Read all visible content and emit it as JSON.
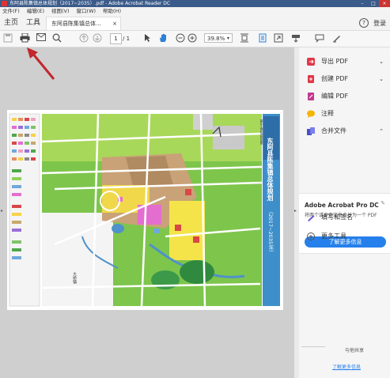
{
  "window": {
    "title": "东阿县陈集镇总体规划（2017~2035）.pdf - Adobe Acrobat Reader DC"
  },
  "menu": {
    "items": [
      "文件(F)",
      "编辑(E)",
      "视图(V)",
      "窗口(W)",
      "帮助(H)"
    ]
  },
  "tabs": {
    "home": "主页",
    "tools": "工具",
    "doc": "东阿县陈集镇总体...",
    "close": "×"
  },
  "header": {
    "help": "?",
    "login": "登录"
  },
  "toolbar": {
    "page_current": "1",
    "page_total": "/ 1",
    "zoom": "39.8%"
  },
  "map": {
    "title": "东阿县陈集镇总体规划",
    "years": "（2017~2035年）",
    "subtitle": "镇区土地利用规划图",
    "place": "大桥镇"
  },
  "panel": {
    "tools": [
      {
        "label": "导出 PDF",
        "icon": "export-pdf-icon",
        "color": "#e0384a"
      },
      {
        "label": "创建 PDF",
        "icon": "create-pdf-icon",
        "color": "#e0384a"
      },
      {
        "label": "编辑 PDF",
        "icon": "edit-pdf-icon",
        "color": "#c23a8f"
      },
      {
        "label": "注释",
        "icon": "comment-icon",
        "color": "#f5b400"
      },
      {
        "label": "合并文件",
        "icon": "combine-files-icon",
        "color": "#4a4fc9"
      }
    ],
    "promo": {
      "heading": "Adobe Acrobat Pro DC",
      "desc": "将两个或更多文件合并为一个 PDF",
      "button": "了解更多信息"
    },
    "more": [
      {
        "label": "填写和签名",
        "icon": "fill-sign-icon"
      },
      {
        "label": "更多工具",
        "icon": "more-tools-icon"
      }
    ],
    "share": {
      "label": "与他共享",
      "link": "了解更多信息"
    }
  },
  "colors": {
    "accent": "#2680eb",
    "title_bar": "#3b5b8a"
  }
}
